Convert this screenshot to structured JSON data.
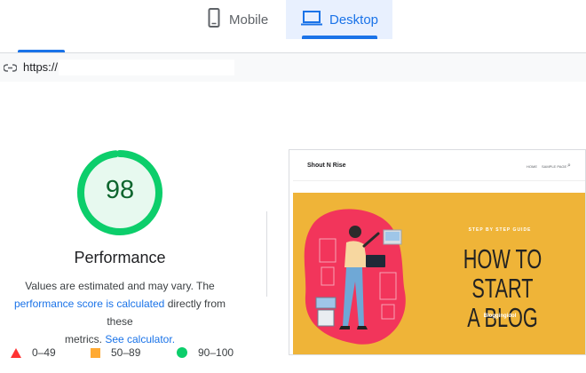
{
  "tabs": [
    {
      "label": "Mobile",
      "icon": "phone-icon"
    },
    {
      "label": "Desktop",
      "icon": "laptop-icon",
      "selected": true
    }
  ],
  "url": {
    "icon": "link-icon",
    "text": "https://"
  },
  "score": {
    "value": "98",
    "fraction": 0.98,
    "title": "Performance",
    "color": "#0cce6b",
    "text_color": "#0d652d"
  },
  "description": {
    "line1": "Values are estimated and may vary. The",
    "link1": "performance score is calculated",
    "mid": " directly from these",
    "line3_prefix": "metrics. ",
    "link2": "See calculator.",
    "link_color": "#1a73e8"
  },
  "legend": [
    {
      "shape": "triangle",
      "color": "#ff3333",
      "label": "0–49"
    },
    {
      "shape": "square",
      "color": "#ffaa33",
      "label": "50–89"
    },
    {
      "shape": "circle",
      "color": "#0cce6b",
      "label": "90–100"
    }
  ],
  "preview": {
    "site_name": "Shout N Rise",
    "nav_items": [
      "HOME",
      "SAMPLE PAGE"
    ],
    "kicker": "STEP BY STEP GUIDE",
    "headline_line1": "HOW TO START",
    "headline_line2": "A BLOG",
    "byline": "Bloggingidol",
    "hero_bg": "#efb438",
    "blob_color": "#f2355b"
  }
}
